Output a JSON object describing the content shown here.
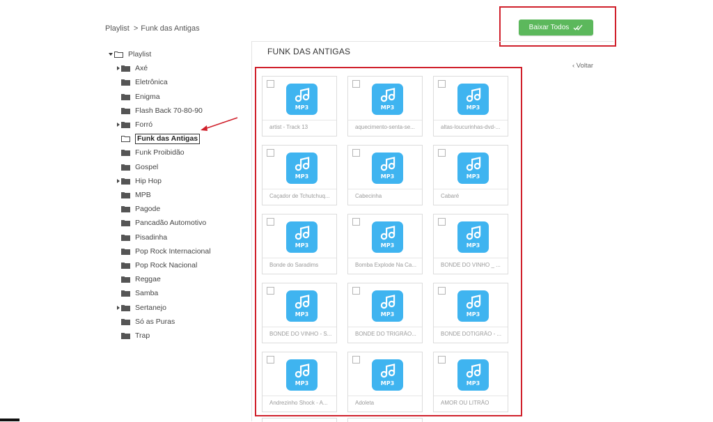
{
  "breadcrumb": {
    "root": "Playlist",
    "separator": ">",
    "current": "Funk das Antigas"
  },
  "actions": {
    "download_all": "Baixar Todos"
  },
  "tree": {
    "root": "Playlist",
    "items": [
      {
        "label": "Axé",
        "expandable": true
      },
      {
        "label": "Eletrônica",
        "expandable": false
      },
      {
        "label": "Enigma",
        "expandable": false
      },
      {
        "label": "Flash Back 70-80-90",
        "expandable": false
      },
      {
        "label": "Forró",
        "expandable": true
      },
      {
        "label": "Funk das Antigas",
        "expandable": false,
        "selected": true
      },
      {
        "label": "Funk Proibidão",
        "expandable": false
      },
      {
        "label": "Gospel",
        "expandable": false
      },
      {
        "label": "Hip Hop",
        "expandable": true
      },
      {
        "label": "MPB",
        "expandable": false
      },
      {
        "label": "Pagode",
        "expandable": false
      },
      {
        "label": "Pancadão Automotivo",
        "expandable": false
      },
      {
        "label": "Pisadinha",
        "expandable": false
      },
      {
        "label": "Pop Rock Internacional",
        "expandable": false
      },
      {
        "label": "Pop Rock Nacional",
        "expandable": false
      },
      {
        "label": "Reggae",
        "expandable": false
      },
      {
        "label": "Samba",
        "expandable": false
      },
      {
        "label": "Sertanejo",
        "expandable": true
      },
      {
        "label": "Só as Puras",
        "expandable": false
      },
      {
        "label": "Trap",
        "expandable": false
      }
    ]
  },
  "main": {
    "title": "FUNK DAS ANTIGAS",
    "back": "‹ Voltar",
    "file_badge": "MP3",
    "files": [
      "artist - Track 13",
      "aquecimento-senta-se...",
      "altas-loucurinhas-dvd-...",
      "Caçador de Tchutchuq...",
      "Cabecinha",
      "Cabaré",
      "Bonde do Saradims",
      "Bomba Explode Na Ca...",
      "BONDE DO VINHO _ ...",
      "BONDE DO VINHO - S...",
      "BONDE DO TRIGRÃO...",
      "BONDE DOTIGRÃO - ...",
      "Andrezinho Shock - A...",
      "Adoleta",
      "AMOR OU LITRÃO"
    ]
  },
  "colors": {
    "accent_green": "#5cb85c",
    "mp3_blue": "#3fb4f0",
    "highlight_red": "#d0202b"
  },
  "icons": {
    "folder": "folder-icon",
    "open_folder": "folder-open-icon",
    "audio": "music-note-icon",
    "download": "double-check-icon"
  }
}
